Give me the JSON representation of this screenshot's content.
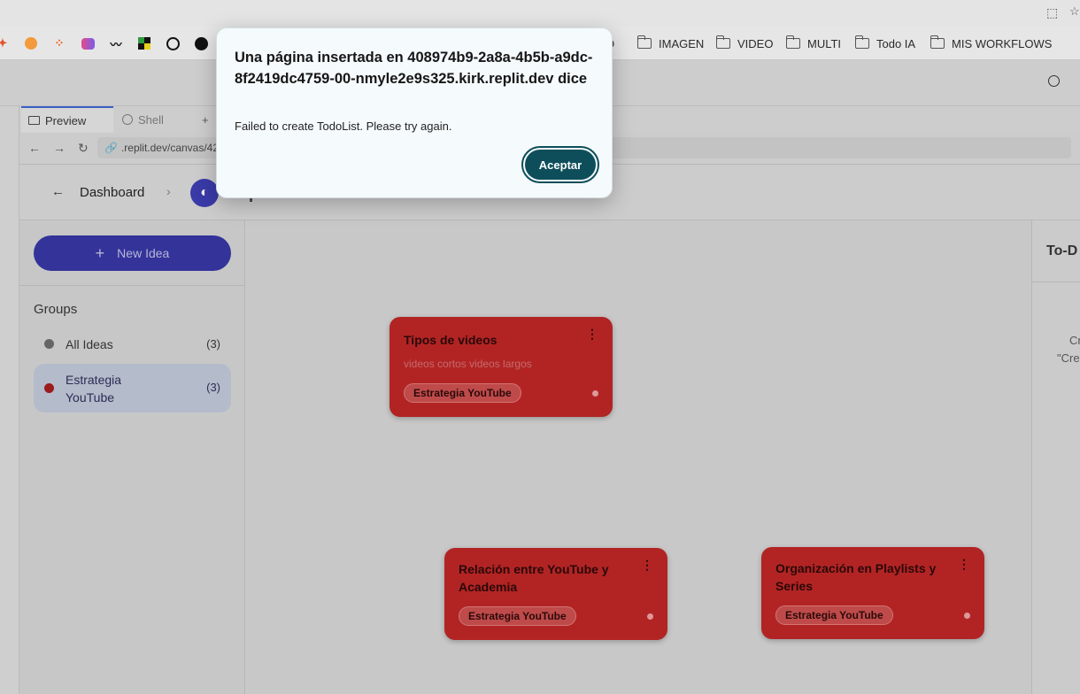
{
  "browser": {
    "bookmarks": [
      {
        "label": "O"
      },
      {
        "label": "IMAGEN"
      },
      {
        "label": "VIDEO"
      },
      {
        "label": "MULTI"
      },
      {
        "label": "Todo IA"
      },
      {
        "label": "MIS WORKFLOWS"
      }
    ],
    "favicons": [
      "figma-icon",
      "orange-circle-icon",
      "dots-icon",
      "pink-app-icon",
      "wave-icon",
      "checker-icon",
      "github-icon",
      "face-icon"
    ]
  },
  "ide": {
    "tabs": [
      {
        "label": "Preview",
        "icon": "monitor-icon"
      },
      {
        "label": "Shell",
        "icon": "terminal-icon"
      }
    ],
    "add_tab": "+",
    "url": ".replit.dev/canvas/42"
  },
  "app": {
    "back_arrow": "←",
    "breadcrumb": "Dashboard",
    "chevron": "›",
    "board_title": "Mi primer tablero de ideas",
    "new_idea": "New Idea",
    "groups_title": "Groups",
    "groups": [
      {
        "label": "All Ideas",
        "count": "(3)",
        "color": "#666666"
      },
      {
        "label": "Estrategia YouTube",
        "count": "(3)",
        "color": "#9a1c1c"
      }
    ],
    "right_panel_title": "To-D",
    "right_panel_line1": "Cr",
    "right_panel_line2": "\"Cre"
  },
  "cards": [
    {
      "title": "Tipos de videos",
      "desc": "videos cortos videos largos",
      "tag": "Estrategia YouTube"
    },
    {
      "title": "Relación entre YouTube y Academia",
      "desc": "",
      "tag": "Estrategia YouTube"
    },
    {
      "title": "Organización en Playlists y Series",
      "desc": "",
      "tag": "Estrategia YouTube"
    }
  ],
  "dialog": {
    "title": "Una página insertada en 408974b9-2a8a-4b5b-a9dc-8f2419dc4759-00-nmyle2e9s325.kirk.replit.dev dice",
    "message": "Failed to create TodoList. Please try again.",
    "ok_button": "Aceptar"
  },
  "colors": {
    "accent": "#0e4e5b",
    "card": "#b22424",
    "primary_button": "#33339a"
  }
}
